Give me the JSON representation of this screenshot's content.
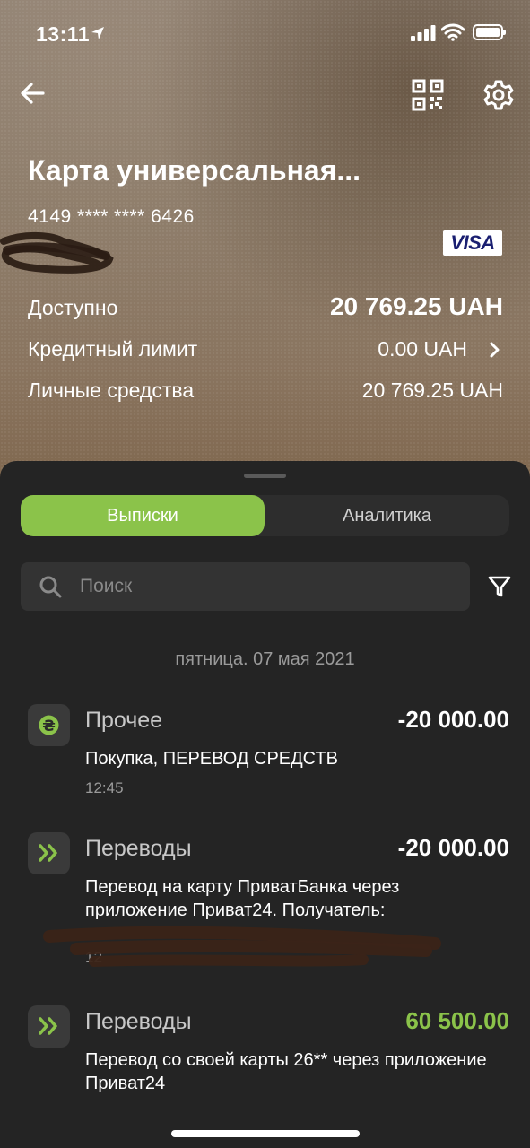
{
  "status_bar": {
    "time": "13:11"
  },
  "card": {
    "title": "Карта универсальная...",
    "number": "4149 **** **** 6426",
    "brand": "VISA",
    "rows": {
      "available": {
        "label": "Доступно",
        "value": "20 769.25 UAH"
      },
      "credit_limit": {
        "label": "Кредитный лимит",
        "value": "0.00 UAH"
      },
      "own_funds": {
        "label": "Личные средства",
        "value": "20 769.25 UAH"
      }
    }
  },
  "tabs": {
    "statements": "Выписки",
    "analytics": "Аналитика",
    "active": "statements"
  },
  "search": {
    "placeholder": "Поиск",
    "value": ""
  },
  "date_header": "пятница. 07 мая 2021",
  "transactions": [
    {
      "category": "Прочее",
      "amount": "-20 000.00",
      "description": "Покупка, ПЕРЕВОД СРЕДСТВ",
      "time": "12:45",
      "icon": "hryvnia-icon",
      "positive": false
    },
    {
      "category": "Переводы",
      "amount": "-20 000.00",
      "description": "Перевод на карту ПриватБанка через приложение Приват24. Получатель:",
      "time": "12",
      "icon": "double-chevron-icon",
      "positive": false
    },
    {
      "category": "Переводы",
      "amount": "60 500.00",
      "description": "Перевод со своей карты 26** через приложение Приват24",
      "time": "",
      "icon": "double-chevron-icon",
      "positive": true
    }
  ],
  "colors": {
    "accent": "#8bc34a",
    "sheet_bg": "#242424",
    "card_bg": "#8a7a68"
  }
}
